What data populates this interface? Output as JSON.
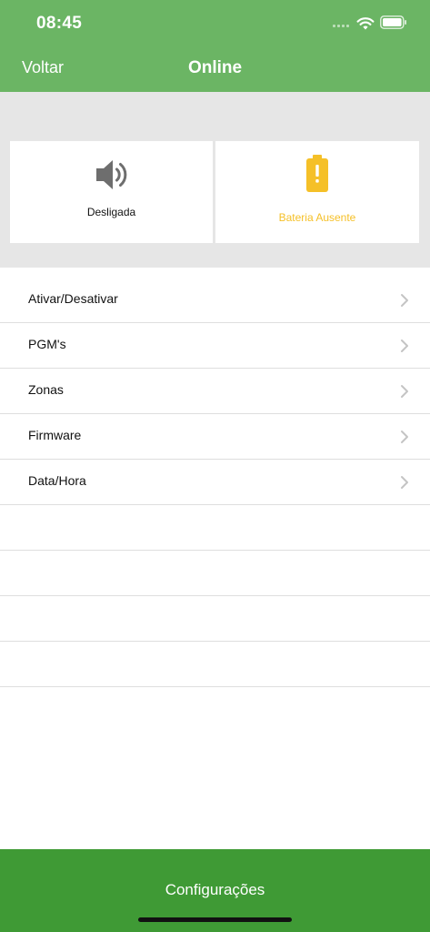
{
  "status_bar": {
    "time": "08:45"
  },
  "nav": {
    "back_label": "Voltar",
    "title": "Online"
  },
  "cards": [
    {
      "label": "Desligada",
      "icon": "speaker-icon",
      "color": "#111111"
    },
    {
      "label": "Bateria Ausente",
      "icon": "battery-warning-icon",
      "color": "#f5c028"
    }
  ],
  "menu": {
    "items": [
      {
        "label": "Ativar/Desativar"
      },
      {
        "label": "PGM's"
      },
      {
        "label": "Zonas"
      },
      {
        "label": "Firmware"
      },
      {
        "label": "Data/Hora"
      }
    ]
  },
  "footer": {
    "label": "Configurações"
  },
  "colors": {
    "header": "#6bb564",
    "footer": "#3f9a35",
    "accent_yellow": "#f5c028",
    "band": "#e6e6e6"
  }
}
